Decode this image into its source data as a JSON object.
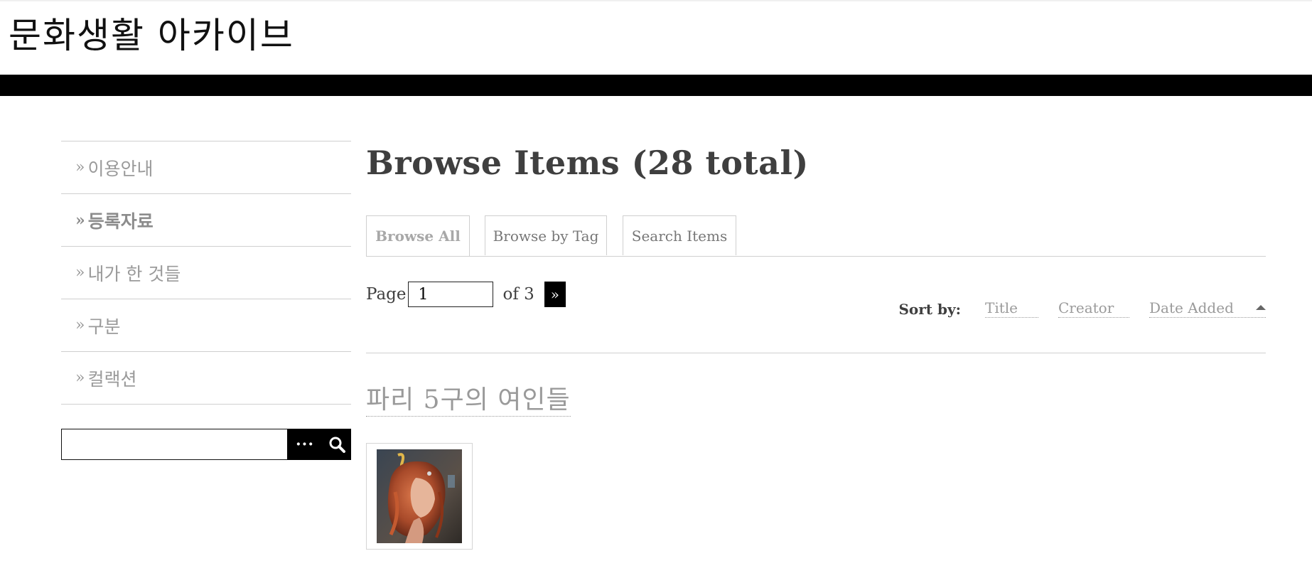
{
  "site": {
    "title": "문화생활 아카이브"
  },
  "sidebar": {
    "items": [
      {
        "label": "이용안내",
        "arrow": "»"
      },
      {
        "label": "등록자료",
        "arrow": "»"
      },
      {
        "label": "내가 한 것들",
        "arrow": "»"
      },
      {
        "label": "구분",
        "arrow": "»"
      },
      {
        "label": "컬랙션",
        "arrow": "»"
      }
    ],
    "search": {
      "value": "",
      "options_label": "···",
      "icon": "search-icon"
    }
  },
  "main": {
    "heading": "Browse Items (28 total)",
    "tabs": [
      {
        "label": "Browse All",
        "active": true
      },
      {
        "label": "Browse by Tag",
        "active": false
      },
      {
        "label": "Search Items",
        "active": false
      }
    ],
    "pager": {
      "page_label": "Page",
      "current_page": "1",
      "of_label": "of 3",
      "next_label": "»"
    },
    "sort": {
      "label": "Sort by:",
      "options": [
        "Title",
        "Creator",
        "Date Added"
      ],
      "active_sort": "Date Added",
      "direction": "ascending"
    },
    "items": [
      {
        "title": "파리 5구의 여인들",
        "thumbnail": "red-haired-woman-painting"
      }
    ]
  },
  "colors": {
    "bar": "#000000",
    "muted_text": "#9a9a9a",
    "heading_text": "#3f3f3f"
  }
}
